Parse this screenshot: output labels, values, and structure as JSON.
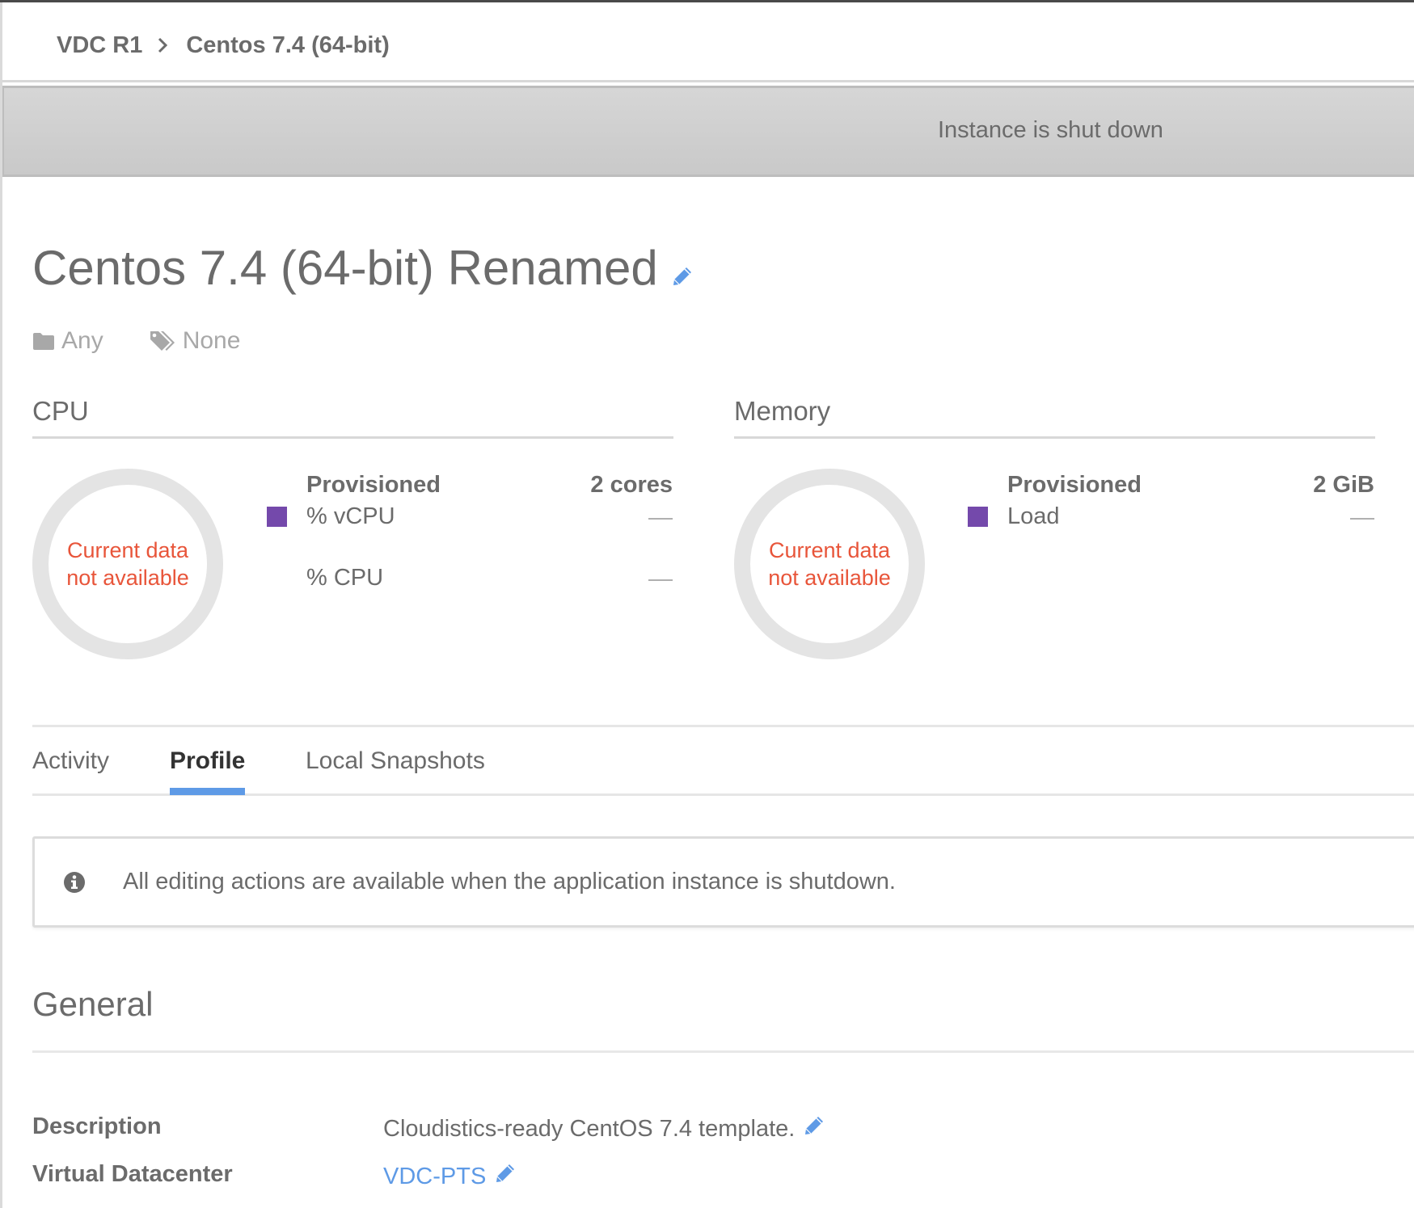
{
  "breadcrumb": {
    "items": [
      "VDC R1",
      "Centos 7.4 (64-bit)"
    ],
    "separator_icon": "chevron-right-icon"
  },
  "banner": {
    "status_text": "Instance is shut down"
  },
  "instance": {
    "title": "Centos 7.4 (64-bit) Renamed",
    "edit_icon": "pencil-icon",
    "folder": "Any",
    "tags": "None"
  },
  "colors": {
    "accent": "#5e9ae6",
    "legend": "#7449ab",
    "error_text": "#e8553a",
    "banner_bg": "#d0d0d0",
    "ring": "#e4e4e4"
  },
  "cpu": {
    "heading": "CPU",
    "ring_text_line1": "Current data",
    "ring_text_line2": "not available",
    "provisioned_label": "Provisioned",
    "provisioned_value": "2 cores",
    "metrics": [
      {
        "label": "% vCPU",
        "value": "—",
        "has_legend": true
      },
      {
        "label": "% CPU",
        "value": "—",
        "has_legend": false
      }
    ]
  },
  "memory": {
    "heading": "Memory",
    "ring_text_line1": "Current data",
    "ring_text_line2": "not available",
    "provisioned_label": "Provisioned",
    "provisioned_value": "2 GiB",
    "metrics": [
      {
        "label": "Load",
        "value": "—",
        "has_legend": true
      }
    ]
  },
  "tabs": [
    {
      "label": "Activity",
      "active": false
    },
    {
      "label": "Profile",
      "active": true
    },
    {
      "label": "Local Snapshots",
      "active": false
    }
  ],
  "info_notice": {
    "icon": "info-circle-icon",
    "text": "All editing actions are available when the application instance is shutdown."
  },
  "general": {
    "heading": "General",
    "properties": [
      {
        "label": "Description",
        "value": "Cloudistics-ready CentOS 7.4 template.",
        "is_link": false,
        "editable": true
      },
      {
        "label": "Virtual Datacenter",
        "value": "VDC-PTS",
        "is_link": true,
        "editable": true
      }
    ]
  }
}
